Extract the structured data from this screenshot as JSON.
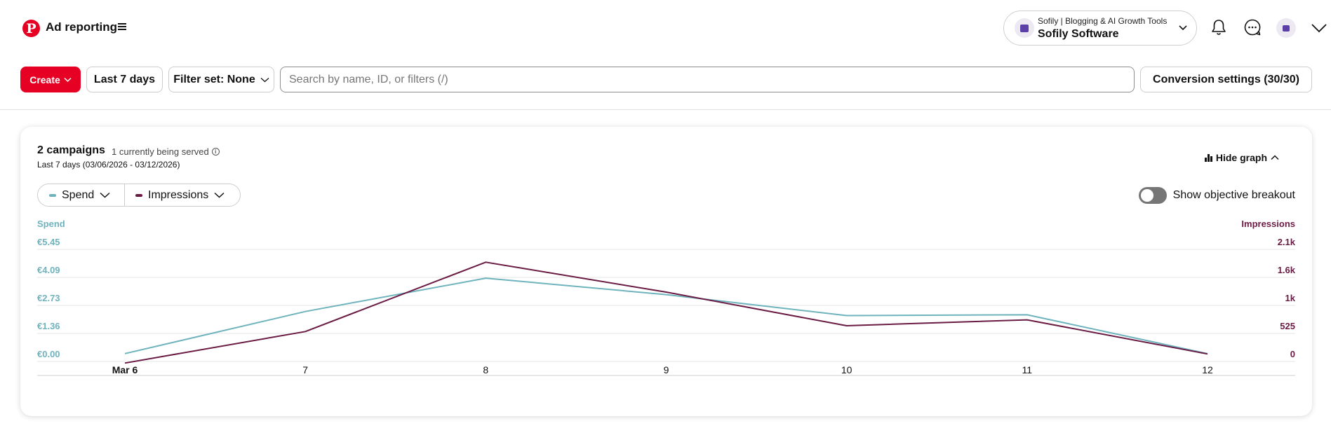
{
  "topbar": {
    "logo_letter": "P",
    "title": "Ad reporting",
    "account": {
      "business": "Sofily | Blogging & AI Growth Tools",
      "name": "Sofily Software"
    }
  },
  "toolbar": {
    "create_label": "Create",
    "date_label": "Last 7 days",
    "filter_label": "Filter set: None",
    "search_placeholder": "Search by name, ID, or filters (/)",
    "conversion_label": "Conversion settings (30/30)"
  },
  "card": {
    "campaigns": "2 campaigns",
    "served": "1 currently being served",
    "date_range": "Last 7 days (03/06/2026 - 03/12/2026)",
    "hide_graph": "Hide graph",
    "metric_1": "Spend",
    "metric_2": "Impressions",
    "toggle_label": "Show objective breakout"
  },
  "colors": {
    "brand": "#e60023",
    "spend": "#6fb3bd",
    "impressions": "#6a1b44"
  },
  "icons": [
    "menu-icon",
    "chevron-down-icon",
    "bell-icon",
    "chat-icon",
    "info-icon",
    "bar-chart-icon",
    "chevron-up-icon"
  ],
  "chart_data": {
    "type": "line",
    "x": [
      "Mar 6",
      "7",
      "8",
      "9",
      "10",
      "11",
      "12"
    ],
    "series": [
      {
        "name": "Spend",
        "axis": "left",
        "values": [
          0.38,
          2.43,
          4.05,
          3.25,
          2.23,
          2.27,
          0.38
        ]
      },
      {
        "name": "Impressions",
        "axis": "right",
        "values": [
          -30,
          560,
          1860,
          1300,
          670,
          780,
          140
        ]
      }
    ],
    "left_axis": {
      "label": "Spend",
      "ticks": [
        "€5.45",
        "€4.09",
        "€2.73",
        "€1.36",
        "€0.00"
      ],
      "range": [
        0,
        5.45
      ]
    },
    "right_axis": {
      "label": "Impressions",
      "ticks": [
        "2.1k",
        "1.6k",
        "1k",
        "525",
        "0"
      ],
      "range": [
        0,
        2100
      ]
    },
    "grid": true,
    "legend": "top-left"
  }
}
